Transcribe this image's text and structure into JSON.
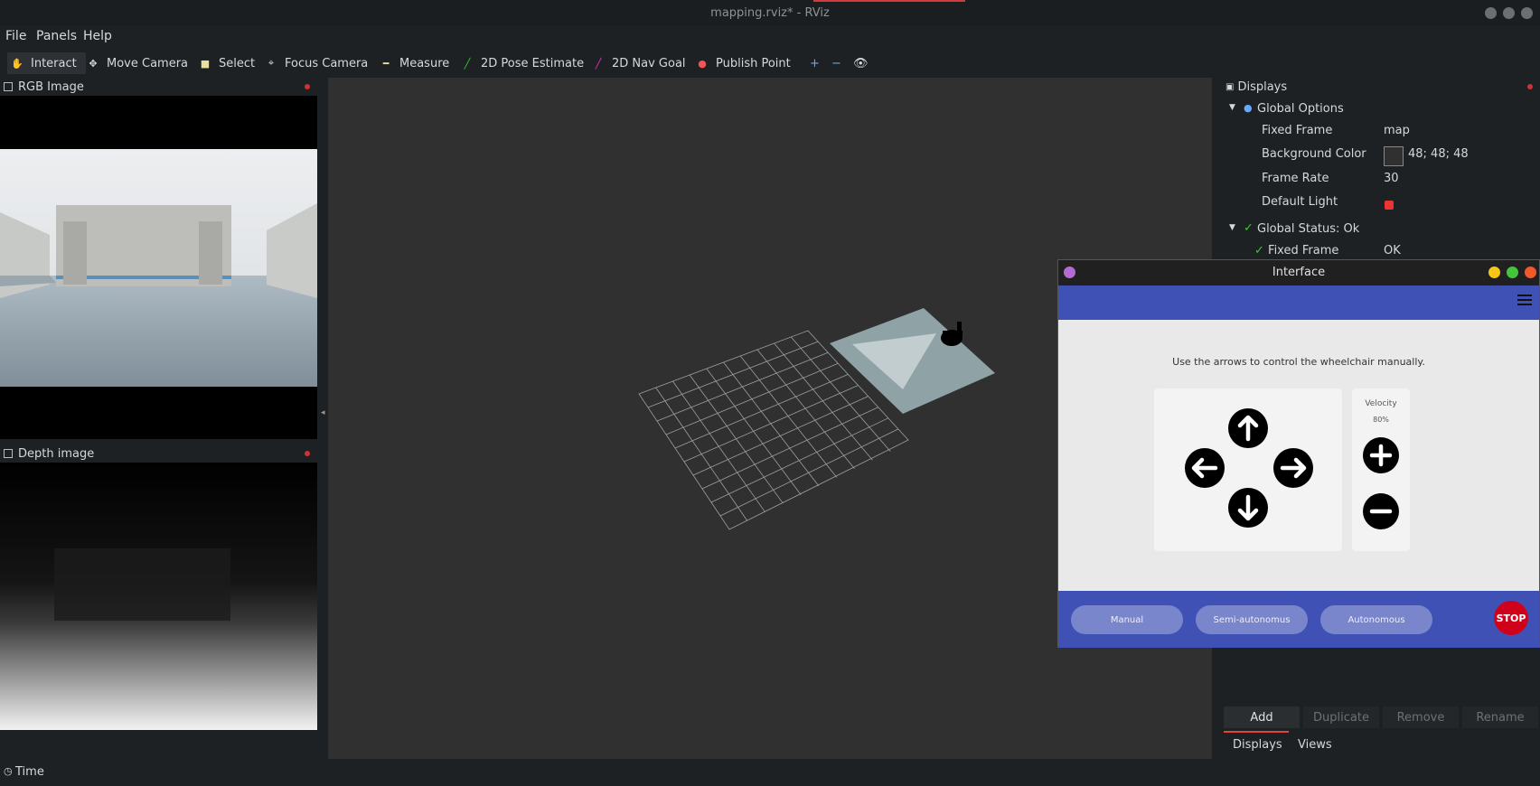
{
  "window": {
    "title": "mapping.rviz* - RViz"
  },
  "menu": {
    "file": "File",
    "panels": "Panels",
    "help": "Help"
  },
  "toolbar": {
    "interact": "Interact",
    "move_camera": "Move Camera",
    "select": "Select",
    "focus_camera": "Focus Camera",
    "measure": "Measure",
    "pose_estimate": "2D Pose Estimate",
    "nav_goal": "2D Nav Goal",
    "publish_point": "Publish Point",
    "plus": "+",
    "minus": "−"
  },
  "rgb_panel": {
    "title": "RGB Image"
  },
  "depth_panel": {
    "title": "Depth image"
  },
  "displays": {
    "title": "Displays",
    "global_options": "Global Options",
    "fixed_frame_label": "Fixed Frame",
    "fixed_frame_value": "map",
    "bg_color_label": "Background Color",
    "bg_color_value": "48; 48; 48",
    "frame_rate_label": "Frame Rate",
    "frame_rate_value": "30",
    "default_light_label": "Default Light",
    "global_status": "Global Status: Ok",
    "status_fixed_frame_label": "Fixed Frame",
    "status_fixed_frame_value": "OK",
    "buttons": {
      "add": "Add",
      "duplicate": "Duplicate",
      "remove": "Remove",
      "rename": "Rename"
    },
    "tabs": {
      "displays": "Displays",
      "views": "Views"
    }
  },
  "time_panel": {
    "title": "Time"
  },
  "interface": {
    "title": "Interface",
    "instruction": "Use the arrows to control the wheelchair manually.",
    "velocity_label": "Velocity",
    "velocity_value": "80%",
    "modes": {
      "manual": "Manual",
      "semi": "Semi-autonomus",
      "auto": "Autonomous"
    },
    "stop": "STOP"
  },
  "colors": {
    "accent": "#3f51b5",
    "stop": "#d0021b",
    "viewport_bg": "#303030"
  }
}
